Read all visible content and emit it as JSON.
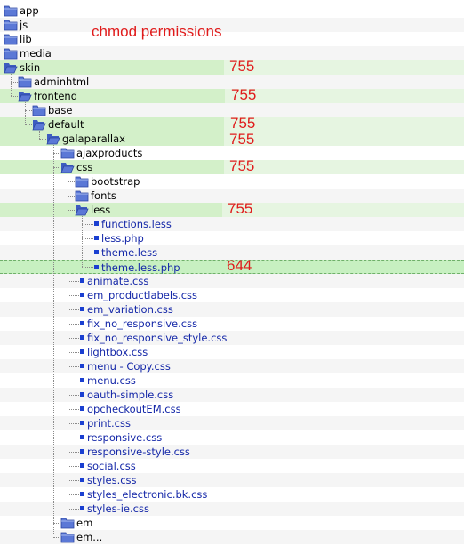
{
  "annotation": "chmod permissions",
  "colors": {
    "folder": "#5b78d6",
    "file": "#1a3fd1",
    "permission_text": "#e01b1b",
    "highlight": "#d3f0c9"
  },
  "tree": [
    {
      "label": "app",
      "type": "folder",
      "depth": 0
    },
    {
      "label": "js",
      "type": "folder",
      "depth": 0
    },
    {
      "label": "lib",
      "type": "folder",
      "depth": 0
    },
    {
      "label": "media",
      "type": "folder",
      "depth": 0
    },
    {
      "label": "skin",
      "type": "folder-open",
      "depth": 0,
      "permission": "755",
      "selected": true
    },
    {
      "label": "adminhtml",
      "type": "folder",
      "depth": 1
    },
    {
      "label": "frontend",
      "type": "folder-open",
      "depth": 1,
      "permission": "755",
      "selected": true
    },
    {
      "label": "base",
      "type": "folder",
      "depth": 2
    },
    {
      "label": "default",
      "type": "folder-open",
      "depth": 2,
      "permission": "755",
      "selected": true
    },
    {
      "label": "galaparallax",
      "type": "folder-open",
      "depth": 3,
      "permission": "755",
      "selected": true
    },
    {
      "label": "ajaxproducts",
      "type": "folder",
      "depth": 4
    },
    {
      "label": "css",
      "type": "folder-open",
      "depth": 4,
      "permission": "755",
      "selected": true
    },
    {
      "label": "bootstrap",
      "type": "folder",
      "depth": 5
    },
    {
      "label": "fonts",
      "type": "folder",
      "depth": 5
    },
    {
      "label": "less",
      "type": "folder-open",
      "depth": 5,
      "permission": "755",
      "selected": true
    },
    {
      "label": "functions.less",
      "type": "file",
      "depth": 6
    },
    {
      "label": "less.php",
      "type": "file",
      "depth": 6
    },
    {
      "label": "theme.less",
      "type": "file",
      "depth": 6
    },
    {
      "label": "theme.less.php",
      "type": "file",
      "depth": 6,
      "permission": "644",
      "selected": true,
      "full_row": true
    },
    {
      "label": "animate.css",
      "type": "file",
      "depth": 5
    },
    {
      "label": "em_productlabels.css",
      "type": "file",
      "depth": 5
    },
    {
      "label": "em_variation.css",
      "type": "file",
      "depth": 5
    },
    {
      "label": "fix_no_responsive.css",
      "type": "file",
      "depth": 5
    },
    {
      "label": "fix_no_responsive_style.css",
      "type": "file",
      "depth": 5
    },
    {
      "label": "lightbox.css",
      "type": "file",
      "depth": 5
    },
    {
      "label": "menu - Copy.css",
      "type": "file",
      "depth": 5
    },
    {
      "label": "menu.css",
      "type": "file",
      "depth": 5
    },
    {
      "label": "oauth-simple.css",
      "type": "file",
      "depth": 5
    },
    {
      "label": "opcheckoutEM.css",
      "type": "file",
      "depth": 5
    },
    {
      "label": "print.css",
      "type": "file",
      "depth": 5
    },
    {
      "label": "responsive.css",
      "type": "file",
      "depth": 5
    },
    {
      "label": "responsive-style.css",
      "type": "file",
      "depth": 5
    },
    {
      "label": "social.css",
      "type": "file",
      "depth": 5
    },
    {
      "label": "styles.css",
      "type": "file",
      "depth": 5
    },
    {
      "label": "styles_electronic.bk.css",
      "type": "file",
      "depth": 5
    },
    {
      "label": "styles-ie.css",
      "type": "file",
      "depth": 5
    },
    {
      "label": "em",
      "type": "folder",
      "depth": 4
    },
    {
      "label": "em...",
      "type": "folder",
      "depth": 4
    }
  ]
}
